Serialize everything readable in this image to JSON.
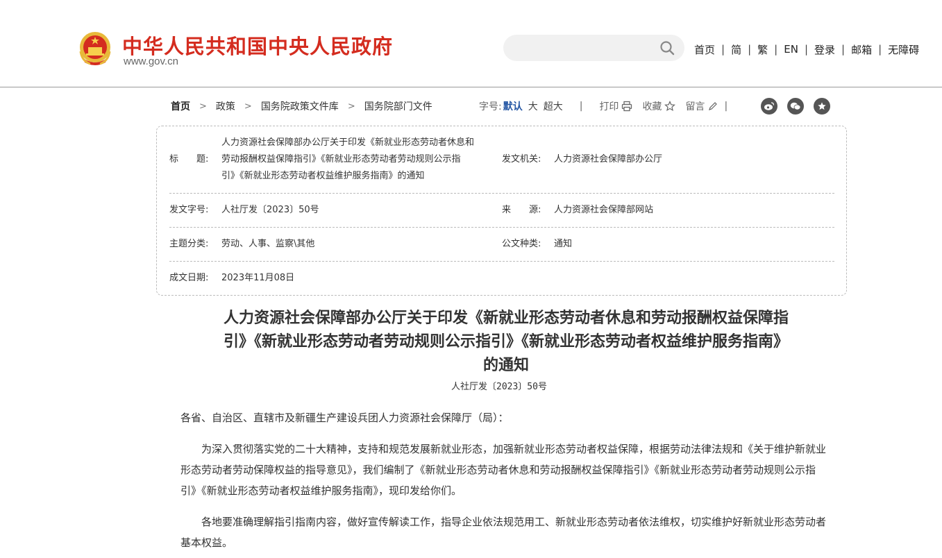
{
  "header": {
    "site_name": "中华人民共和国中央人民政府",
    "site_url": "www.gov.cn",
    "search_placeholder": "",
    "nav": [
      "首页",
      "简",
      "繁",
      "EN",
      "登录",
      "邮箱",
      "无障碍"
    ],
    "colors": {
      "brand_red": "#d42c1f",
      "link_blue": "#2456a4"
    }
  },
  "breadcrumb": [
    "首页",
    "政策",
    "国务院政策文件库",
    "国务院部门文件"
  ],
  "tools": {
    "font_label": "字号:",
    "font_sizes": [
      "默认",
      "大",
      "超大"
    ],
    "print": "打印",
    "favorite": "收藏",
    "comment": "留言",
    "share_icons": [
      "weibo-icon",
      "wechat-icon",
      "star-icon"
    ]
  },
  "info": {
    "title_label": "标　　题:",
    "title_lines": [
      "人力资源社会保障部办公厅关于印发《新就业形态劳动者休息和",
      "劳动报酬权益保障指引》《新就业形态劳动者劳动规则公示指",
      "引》《新就业形态劳动者权益维护服务指南》的通知"
    ],
    "issuer_label": "发文机关:",
    "issuer": "人力资源社会保障部办公厅",
    "docno_label": "发文字号:",
    "docno": "人社厅发〔2023〕50号",
    "source_label": "来　　源:",
    "source": "人力资源社会保障部网站",
    "topic_label": "主题分类:",
    "topic": "劳动、人事、监察\\其他",
    "type_label": "公文种类:",
    "type": "通知",
    "date_label": "成文日期:",
    "date": "2023年11月08日"
  },
  "article": {
    "title_lines": [
      "人力资源社会保障部办公厅关于印发《新就业形态劳动者休息和劳动报酬权益保障指",
      "引》《新就业形态劳动者劳动规则公示指引》《新就业形态劳动者权益维护服务指南》",
      "的通知"
    ],
    "doc_number": "人社厅发〔2023〕50号",
    "salutation": "各省、自治区、直辖市及新疆生产建设兵团人力资源社会保障厅（局）：",
    "paragraphs": [
      "为深入贯彻落实党的二十大精神，支持和规范发展新就业形态，加强新就业形态劳动者权益保障，根据劳动法律法规和《关于维护新就业形态劳动者劳动保障权益的指导意见》，我们编制了《新就业形态劳动者休息和劳动报酬权益保障指引》《新就业形态劳动者劳动规则公示指引》《新就业形态劳动者权益维护服务指南》，现印发给你们。",
      "各地要准确理解指引指南内容，做好宣传解读工作，指导企业依法规范用工、新就业形态劳动者依法维权，切实维护好新就业形态劳动者基本权益。"
    ]
  }
}
